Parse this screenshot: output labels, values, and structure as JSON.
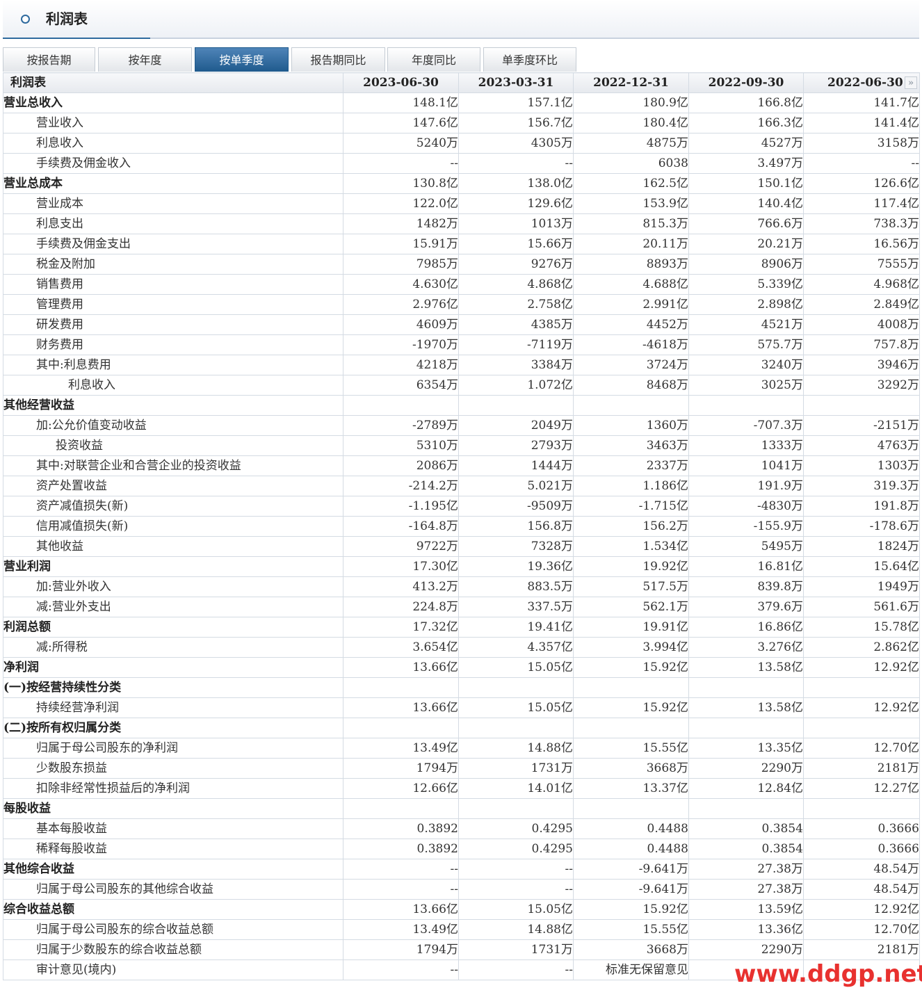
{
  "header": {
    "title": "利润表"
  },
  "tabs": [
    "按报告期",
    "按年度",
    "按单季度",
    "报告期同比",
    "年度同比",
    "单季度环比"
  ],
  "active_tab": 2,
  "table": {
    "corner": "利润表",
    "columns": [
      "2023-06-30",
      "2023-03-31",
      "2022-12-31",
      "2022-09-30",
      "2022-06-30"
    ],
    "rows": [
      {
        "label": "营业总收入",
        "lv": 0,
        "b": true,
        "v": [
          "148.1亿",
          "157.1亿",
          "180.9亿",
          "166.8亿",
          "141.7亿"
        ]
      },
      {
        "label": "营业收入",
        "lv": 1,
        "v": [
          "147.6亿",
          "156.7亿",
          "180.4亿",
          "166.3亿",
          "141.4亿"
        ]
      },
      {
        "label": "利息收入",
        "lv": 1,
        "v": [
          "5240万",
          "4305万",
          "4875万",
          "4527万",
          "3158万"
        ]
      },
      {
        "label": "手续费及佣金收入",
        "lv": 1,
        "v": [
          "--",
          "--",
          "6038",
          "3.497万",
          "--"
        ]
      },
      {
        "label": "营业总成本",
        "lv": 0,
        "b": true,
        "v": [
          "130.8亿",
          "138.0亿",
          "162.5亿",
          "150.1亿",
          "126.6亿"
        ]
      },
      {
        "label": "营业成本",
        "lv": 1,
        "v": [
          "122.0亿",
          "129.6亿",
          "153.9亿",
          "140.4亿",
          "117.4亿"
        ]
      },
      {
        "label": "利息支出",
        "lv": 1,
        "v": [
          "1482万",
          "1013万",
          "815.3万",
          "766.6万",
          "738.3万"
        ]
      },
      {
        "label": "手续费及佣金支出",
        "lv": 1,
        "v": [
          "15.91万",
          "15.66万",
          "20.11万",
          "20.21万",
          "16.56万"
        ]
      },
      {
        "label": "税金及附加",
        "lv": 1,
        "v": [
          "7985万",
          "9276万",
          "8893万",
          "8906万",
          "7555万"
        ]
      },
      {
        "label": "销售费用",
        "lv": 1,
        "v": [
          "4.630亿",
          "4.868亿",
          "4.688亿",
          "5.339亿",
          "4.968亿"
        ]
      },
      {
        "label": "管理费用",
        "lv": 1,
        "v": [
          "2.976亿",
          "2.758亿",
          "2.991亿",
          "2.898亿",
          "2.849亿"
        ]
      },
      {
        "label": "研发费用",
        "lv": 1,
        "v": [
          "4609万",
          "4385万",
          "4452万",
          "4521万",
          "4008万"
        ]
      },
      {
        "label": "财务费用",
        "lv": 1,
        "v": [
          "-1970万",
          "-7119万",
          "-4618万",
          "575.7万",
          "757.8万"
        ]
      },
      {
        "label": "其中:利息费用",
        "lv": 1,
        "v": [
          "4218万",
          "3384万",
          "3724万",
          "3240万",
          "3946万"
        ]
      },
      {
        "label": "利息收入",
        "lv": 3,
        "v": [
          "6354万",
          "1.072亿",
          "8468万",
          "3025万",
          "3292万"
        ]
      },
      {
        "label": "其他经营收益",
        "lv": 0,
        "b": true,
        "v": [
          "",
          "",
          "",
          "",
          ""
        ]
      },
      {
        "label": "加:公允价值变动收益",
        "lv": 1,
        "v": [
          "-2789万",
          "2049万",
          "1360万",
          "-707.3万",
          "-2151万"
        ]
      },
      {
        "label": "投资收益",
        "lv": 2,
        "v": [
          "5310万",
          "2793万",
          "3463万",
          "1333万",
          "4763万"
        ]
      },
      {
        "label": "其中:对联营企业和合营企业的投资收益",
        "lv": 1,
        "v": [
          "2086万",
          "1444万",
          "2337万",
          "1041万",
          "1303万"
        ]
      },
      {
        "label": "资产处置收益",
        "lv": 1,
        "v": [
          "-214.2万",
          "5.021万",
          "1.186亿",
          "191.9万",
          "319.3万"
        ]
      },
      {
        "label": "资产减值损失(新)",
        "lv": 1,
        "v": [
          "-1.195亿",
          "-9509万",
          "-1.715亿",
          "-4830万",
          "191.8万"
        ]
      },
      {
        "label": "信用减值损失(新)",
        "lv": 1,
        "v": [
          "-164.8万",
          "156.8万",
          "156.2万",
          "-155.9万",
          "-178.6万"
        ]
      },
      {
        "label": "其他收益",
        "lv": 1,
        "v": [
          "9722万",
          "7328万",
          "1.534亿",
          "5495万",
          "1824万"
        ]
      },
      {
        "label": "营业利润",
        "lv": 0,
        "b": true,
        "v": [
          "17.30亿",
          "19.36亿",
          "19.92亿",
          "16.81亿",
          "15.64亿"
        ]
      },
      {
        "label": "加:营业外收入",
        "lv": 1,
        "v": [
          "413.2万",
          "883.5万",
          "517.5万",
          "839.8万",
          "1949万"
        ]
      },
      {
        "label": "减:营业外支出",
        "lv": 1,
        "v": [
          "224.8万",
          "337.5万",
          "562.1万",
          "379.6万",
          "561.6万"
        ]
      },
      {
        "label": "利润总额",
        "lv": 0,
        "b": true,
        "v": [
          "17.32亿",
          "19.41亿",
          "19.91亿",
          "16.86亿",
          "15.78亿"
        ]
      },
      {
        "label": "减:所得税",
        "lv": 1,
        "v": [
          "3.654亿",
          "4.357亿",
          "3.994亿",
          "3.276亿",
          "2.862亿"
        ]
      },
      {
        "label": "净利润",
        "lv": 0,
        "b": true,
        "v": [
          "13.66亿",
          "15.05亿",
          "15.92亿",
          "13.58亿",
          "12.92亿"
        ]
      },
      {
        "label": "(一)按经营持续性分类",
        "lv": 0,
        "b": true,
        "v": [
          "",
          "",
          "",
          "",
          ""
        ]
      },
      {
        "label": "持续经营净利润",
        "lv": 1,
        "v": [
          "13.66亿",
          "15.05亿",
          "15.92亿",
          "13.58亿",
          "12.92亿"
        ]
      },
      {
        "label": "(二)按所有权归属分类",
        "lv": 0,
        "b": true,
        "v": [
          "",
          "",
          "",
          "",
          ""
        ]
      },
      {
        "label": "归属于母公司股东的净利润",
        "lv": 1,
        "v": [
          "13.49亿",
          "14.88亿",
          "15.55亿",
          "13.35亿",
          "12.70亿"
        ]
      },
      {
        "label": "少数股东损益",
        "lv": 1,
        "v": [
          "1794万",
          "1731万",
          "3668万",
          "2290万",
          "2181万"
        ]
      },
      {
        "label": "扣除非经常性损益后的净利润",
        "lv": 1,
        "v": [
          "12.66亿",
          "14.01亿",
          "13.37亿",
          "12.84亿",
          "12.27亿"
        ]
      },
      {
        "label": "每股收益",
        "lv": 0,
        "b": true,
        "v": [
          "",
          "",
          "",
          "",
          ""
        ]
      },
      {
        "label": "基本每股收益",
        "lv": 1,
        "v": [
          "0.3892",
          "0.4295",
          "0.4488",
          "0.3854",
          "0.3666"
        ]
      },
      {
        "label": "稀释每股收益",
        "lv": 1,
        "v": [
          "0.3892",
          "0.4295",
          "0.4488",
          "0.3854",
          "0.3666"
        ]
      },
      {
        "label": "其他综合收益",
        "lv": 0,
        "b": true,
        "v": [
          "--",
          "--",
          "-9.641万",
          "27.38万",
          "48.54万"
        ]
      },
      {
        "label": "归属于母公司股东的其他综合收益",
        "lv": 1,
        "v": [
          "--",
          "--",
          "-9.641万",
          "27.38万",
          "48.54万"
        ]
      },
      {
        "label": "综合收益总额",
        "lv": 0,
        "b": true,
        "v": [
          "13.66亿",
          "15.05亿",
          "15.92亿",
          "13.59亿",
          "12.92亿"
        ]
      },
      {
        "label": "归属于母公司股东的综合收益总额",
        "lv": 1,
        "v": [
          "13.49亿",
          "14.88亿",
          "15.55亿",
          "13.36亿",
          "12.70亿"
        ]
      },
      {
        "label": "归属于少数股东的综合收益总额",
        "lv": 1,
        "v": [
          "1794万",
          "1731万",
          "3668万",
          "2290万",
          "2181万"
        ]
      },
      {
        "label": "审计意见(境内)",
        "lv": 1,
        "v": [
          "--",
          "--",
          "标准无保留意见",
          "",
          ""
        ]
      }
    ]
  },
  "watermark": "www.ddgp.net",
  "colors": {
    "accent": "#2e6a9e",
    "active_tab": "#1f5a8d",
    "watermark": "#e8312f"
  },
  "icons": {
    "header": "circle-icon",
    "more": "double-chevron-right-icon",
    "more_glyph": "»"
  }
}
